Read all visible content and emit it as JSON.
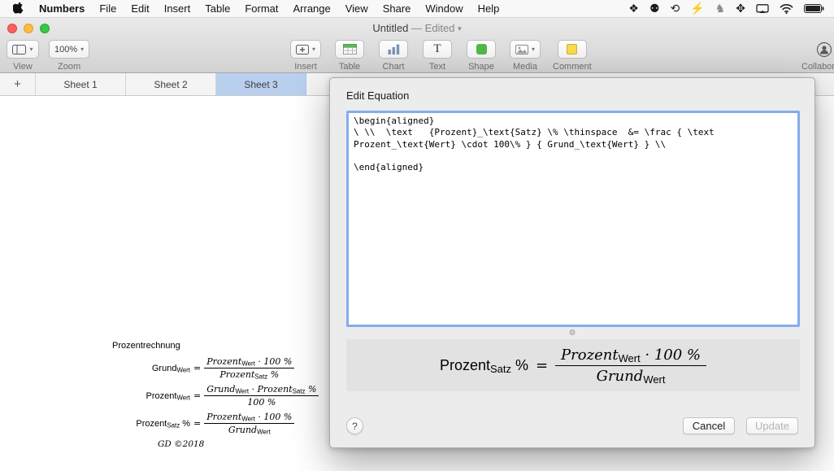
{
  "menu_bar": {
    "items": [
      "Numbers",
      "File",
      "Edit",
      "Insert",
      "Table",
      "Format",
      "Arrange",
      "View",
      "Share",
      "Window",
      "Help"
    ],
    "status_icons": [
      {
        "name": "dropbox-icon",
        "glyph": "❖"
      },
      {
        "name": "creature-icon",
        "glyph": "⚉"
      },
      {
        "name": "time-machine-icon",
        "glyph": "⟲"
      },
      {
        "name": "lightning-icon",
        "glyph": "⚡"
      },
      {
        "name": "silhouette-icon",
        "glyph": "♞"
      },
      {
        "name": "move-arrows-icon",
        "glyph": "✥"
      }
    ]
  },
  "window": {
    "title": "Untitled",
    "edited": "— Edited",
    "caret": "▾"
  },
  "toolbar": {
    "view_label": "View",
    "zoom_value": "100%",
    "zoom_label": "Zoom",
    "insert_label": "Insert",
    "table_label": "Table",
    "chart_label": "Chart",
    "text_label": "Text",
    "shape_label": "Shape",
    "media_label": "Media",
    "comment_label": "Comment",
    "collaborate_label": "Collaborate",
    "caret": "▾",
    "text_icon_glyph": "T"
  },
  "sheet_tabs": {
    "add": "+",
    "tabs": [
      {
        "label": "Sheet 1"
      },
      {
        "label": "Sheet 2"
      },
      {
        "label": "Sheet 3"
      }
    ],
    "active_index": 2
  },
  "canvas": {
    "heading": "Prozentrechnung",
    "eq1": {
      "lhs_main": "Grund",
      "lhs_sub": "Wert",
      "rel": "=",
      "num_a": "Prozent",
      "num_a_sub": "Wert",
      "num_b": " · 100 %",
      "den_a": "Prozent",
      "den_a_sub": "Satz",
      "den_b": " %"
    },
    "eq2": {
      "lhs_main": "Prozent",
      "lhs_sub": "Wert",
      "rel": "=",
      "num_a": "Grund",
      "num_a_sub": "Wert",
      "num_b": " · ",
      "num_c": "Prozent",
      "num_c_sub": "Satz",
      "num_d": " %",
      "den_a": "100 %"
    },
    "eq3": {
      "lhs_main": "Prozent",
      "lhs_sub": "Satz",
      "lhs_rest": " %",
      "rel": "=",
      "num_a": "Prozent",
      "num_a_sub": "Wert",
      "num_b": " · 100 %",
      "den_a": "Grund",
      "den_a_sub": "Wert"
    },
    "footer": "GD ©2018"
  },
  "dialog": {
    "title": "Edit Equation",
    "latex": "\\begin{aligned}\n\\ \\\\  \\text   {Prozent}_\\text{Satz} \\% \\thinspace  &= \\frac { \\text Prozent_\\text{Wert} \\cdot 100\\% } { Grund_\\text{Wert} } \\\\\n\n\\end{aligned}",
    "preview": {
      "lhs_main": "Prozent",
      "lhs_sub": "Satz",
      "lhs_rest": " %",
      "rel": "=",
      "num_a": "Prozent",
      "num_a_sub": "Wert",
      "num_b": " · 100 %",
      "den_a": "Grund",
      "den_a_sub": "Wert"
    },
    "help": "?",
    "cancel": "Cancel",
    "update": "Update"
  },
  "colors": {
    "active_tab": "#b9cfee",
    "focus_ring": "#84acee",
    "table_green": "#5cb85c",
    "shape_green": "#50b848",
    "comment_yellow": "#f7d94c",
    "chart_blue": "#7b93b5",
    "traffic_red": "#fc615d",
    "traffic_yellow": "#fdbc40",
    "traffic_green": "#34c84a"
  }
}
